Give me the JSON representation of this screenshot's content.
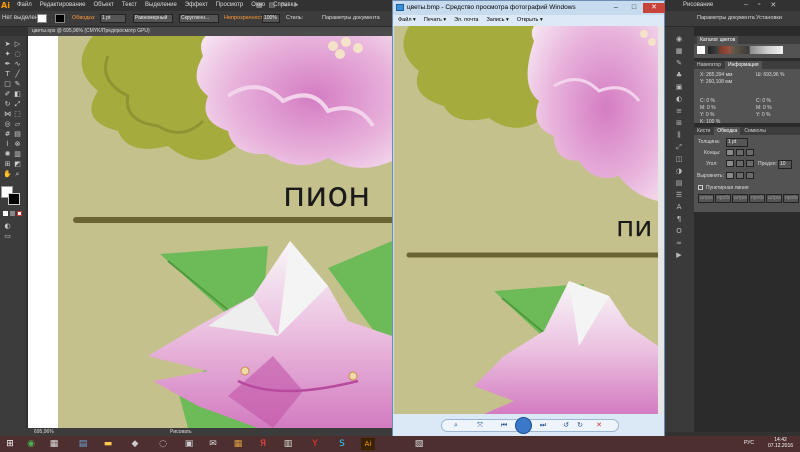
{
  "illustrator": {
    "logo": "Ai",
    "menu": [
      "Файл",
      "Редактирование",
      "Объект",
      "Текст",
      "Выделение",
      "Эффект",
      "Просмотр",
      "Окно",
      "Справка"
    ],
    "workspace": "Рисование",
    "controlbar": {
      "selection_label": "Нет выделения",
      "stroke_label": "Обводка:",
      "stroke_value": "1 pt",
      "brush_value": "Равномерный",
      "profile_value": "Скругленн...",
      "opacity_label": "Непрозрачность:",
      "opacity_value": "100%",
      "style_label": "Стиль:",
      "doc_settings": "Параметры документа",
      "prefs": "Установки"
    },
    "doc_tab": "цветы.eps @ 695,96% (CMYK/Предпросмотр GPU)",
    "zoom": "695,96%",
    "status": "Рисовать",
    "canvas_text": "пион"
  },
  "panels": {
    "color_guide_title": "Каталог цветов",
    "tabs_nav": [
      "Навигатор",
      "Информация"
    ],
    "info": {
      "x": "X: 285,394 мм",
      "y": "Y: 260,108 мм",
      "w": "Ш: 693,96 %",
      "c": "C: 0 %",
      "m": "M: 0 %",
      "yy": "Y: 0 %",
      "k": "K: 100 %"
    },
    "tabs_stroke": [
      "Кисти",
      "Обводка",
      "Символы"
    ],
    "stroke": {
      "weight_label": "Толщина:",
      "weight_value": "1 pt",
      "cap_label": "Концы:",
      "corner_label": "Угол:",
      "limit_label": "Предел:",
      "limit_value": "10",
      "align_label": "Выровнять:",
      "dashed_label": "Пунктирная линия",
      "dash_cells": [
        "штрих",
        "пробел",
        "штрих",
        "пробел",
        "штрих",
        "пробел"
      ]
    }
  },
  "viewer": {
    "title": "цветы.bmp - Средство просмотра фотографий Windows",
    "menu": [
      "Файл ▾",
      "Печать ▾",
      "Эл. почта",
      "Запись ▾",
      "Открыть ▾"
    ],
    "image_text": "пи",
    "controls": [
      "zoom-icon",
      "fit-icon",
      "prev-icon",
      "slideshow-icon",
      "next-icon",
      "rotate-left-icon",
      "rotate-right-icon",
      "delete-icon"
    ]
  },
  "taskbar": {
    "time": "14:42",
    "date": "07.12.2016",
    "lang": "РУС"
  },
  "colors": {
    "canvas_bg": "#c5c18d",
    "peony_pink": "#d98ac7",
    "leaf_green": "#6dbb58",
    "foliage_olive": "#a6ab3e",
    "ai_orange": "#ff9a00"
  }
}
